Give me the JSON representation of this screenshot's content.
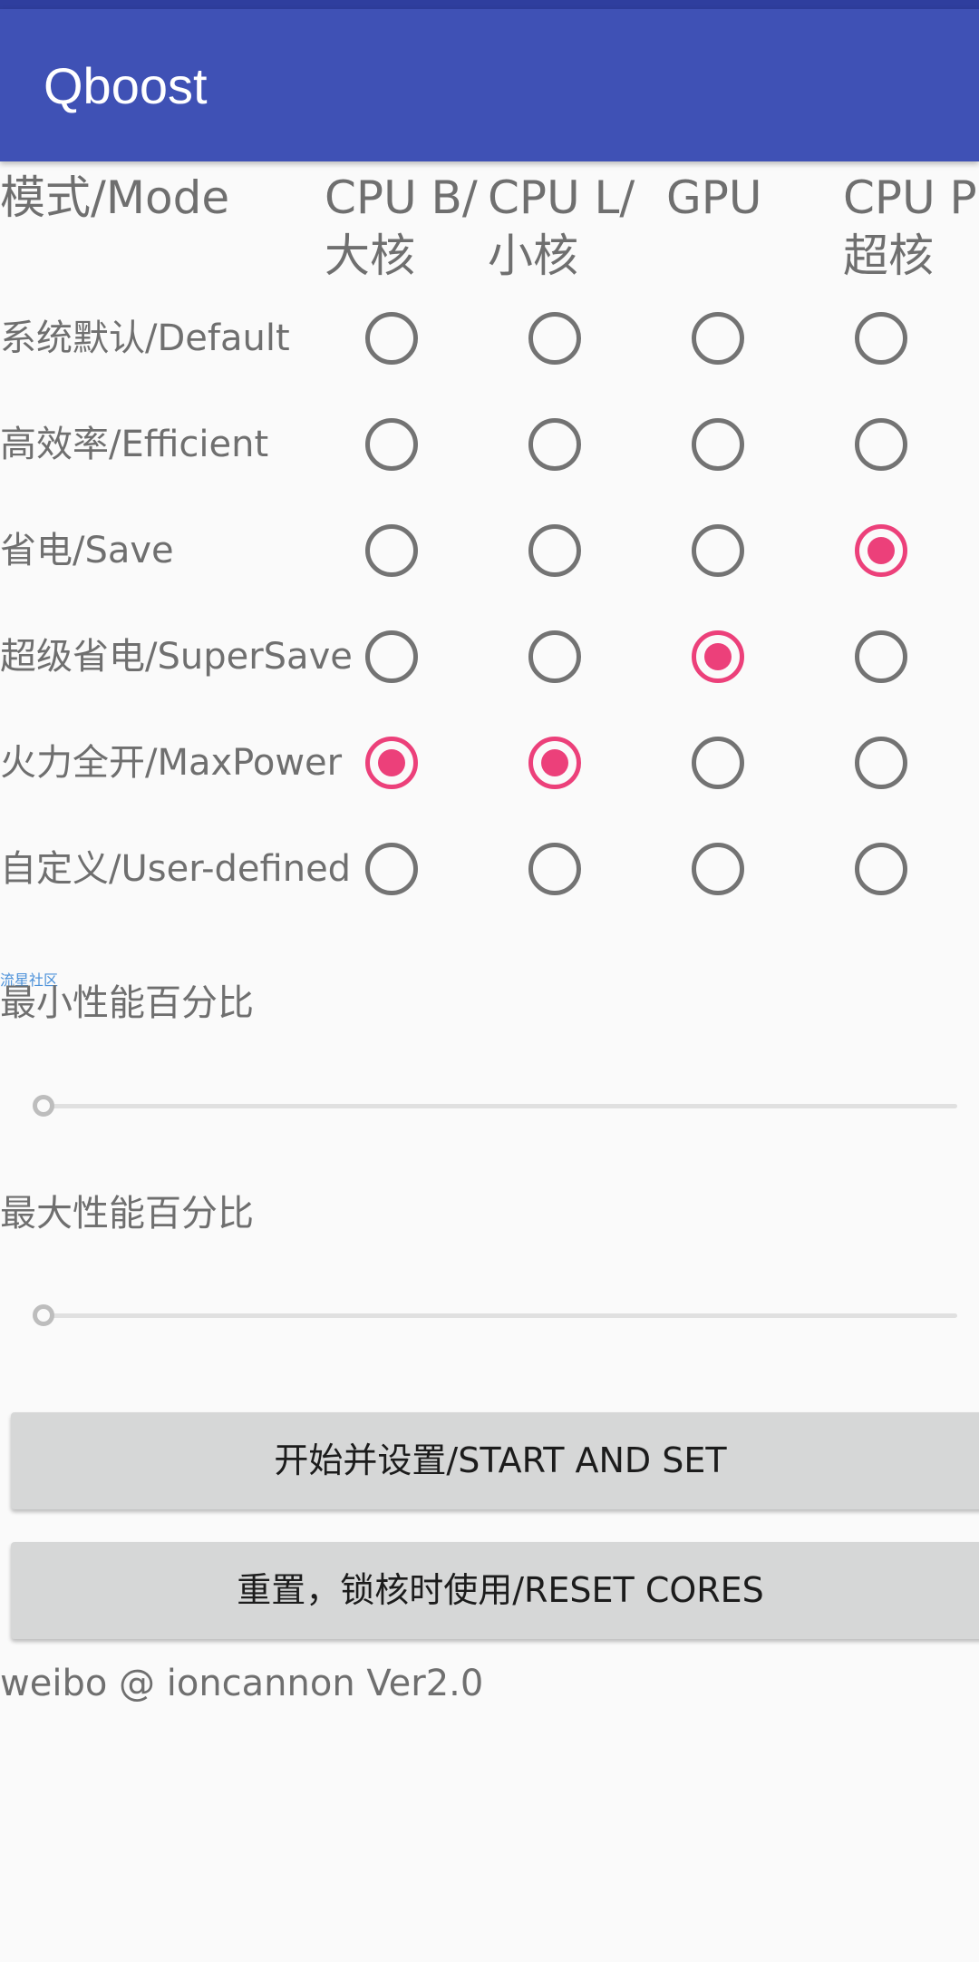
{
  "app": {
    "title": "Qboost"
  },
  "table": {
    "headers": {
      "mode": "模式/Mode",
      "cpu_big": [
        "CPU B/",
        "大核"
      ],
      "cpu_little": [
        "CPU L/",
        ""
      ],
      "cpu_little_line2": "小核",
      "gpu": "GPU",
      "cpu_prime": [
        "CPU P",
        "超核"
      ]
    },
    "rows": [
      {
        "label": "系统默认/Default",
        "selected": [
          false,
          false,
          false,
          false
        ]
      },
      {
        "label": "高效率/Efficient",
        "selected": [
          false,
          false,
          false,
          false
        ]
      },
      {
        "label": "省电/Save",
        "selected": [
          false,
          false,
          false,
          true
        ]
      },
      {
        "label": "超级省电/SuperSave",
        "selected": [
          false,
          false,
          true,
          false
        ]
      },
      {
        "label": "火力全开/MaxPower",
        "selected": [
          true,
          true,
          false,
          false
        ]
      },
      {
        "label": "自定义/User-defined",
        "selected": [
          false,
          false,
          false,
          false
        ]
      }
    ]
  },
  "watermark": "流星社区",
  "sliders": {
    "min_label": "最小性能百分比",
    "min_value": 0,
    "max_label": "最大性能百分比",
    "max_value": 0
  },
  "buttons": {
    "start": "开始并设置/START AND SET",
    "reset": "重置，锁核时使用/RESET CORES"
  },
  "footer": "weibo @ ioncannon Ver2.0",
  "colors": {
    "app_bar": "#3f51b5",
    "status_bar": "#2f3e9e",
    "accent": "#ec407a",
    "button_bg": "#d6d7d7"
  }
}
